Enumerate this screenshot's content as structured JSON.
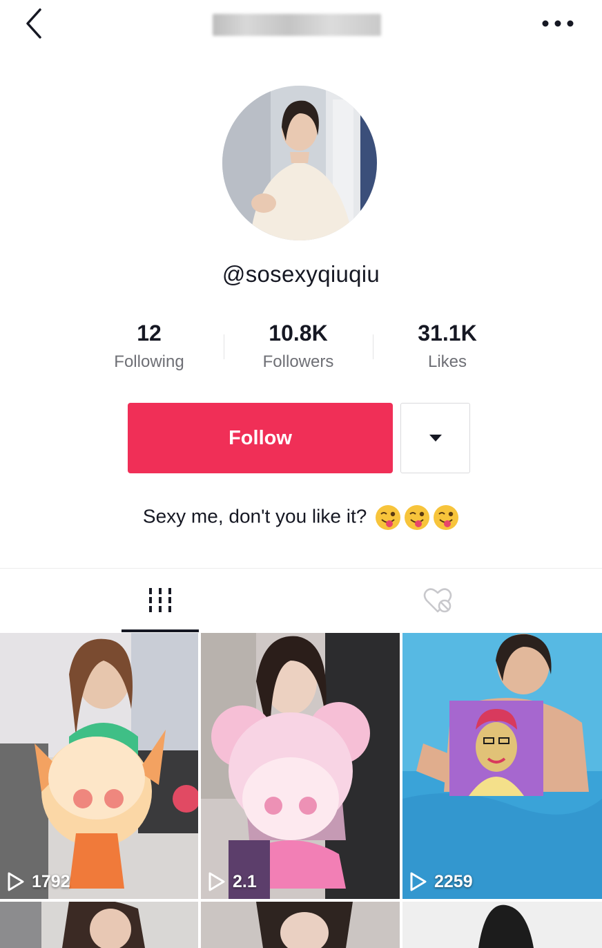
{
  "header": {
    "back_icon": "chevron-left-icon",
    "title": "",
    "more_icon": "more-horizontal-icon"
  },
  "profile": {
    "username": "@sosexyqiuqiu",
    "stats": [
      {
        "value": "12",
        "label": "Following"
      },
      {
        "value": "10.8K",
        "label": "Followers"
      },
      {
        "value": "31.1K",
        "label": "Likes"
      }
    ],
    "follow_label": "Follow",
    "dropdown_icon": "caret-down-icon",
    "bio": "Sexy me, don't you like it?",
    "bio_emoji": [
      "winking-face-with-tongue",
      "winking-face-with-tongue",
      "winking-face-with-tongue"
    ]
  },
  "tabs": [
    {
      "icon": "videos-grid-icon",
      "active": true
    },
    {
      "icon": "liked-heart-icon",
      "active": false
    }
  ],
  "videos": [
    {
      "plays": "1792"
    },
    {
      "plays": "2.1"
    },
    {
      "plays": "2259"
    },
    {
      "plays": ""
    },
    {
      "plays": ""
    },
    {
      "plays": ""
    }
  ],
  "colors": {
    "accent": "#f02f57",
    "text_primary": "#161823",
    "text_secondary": "#6e6f75"
  }
}
